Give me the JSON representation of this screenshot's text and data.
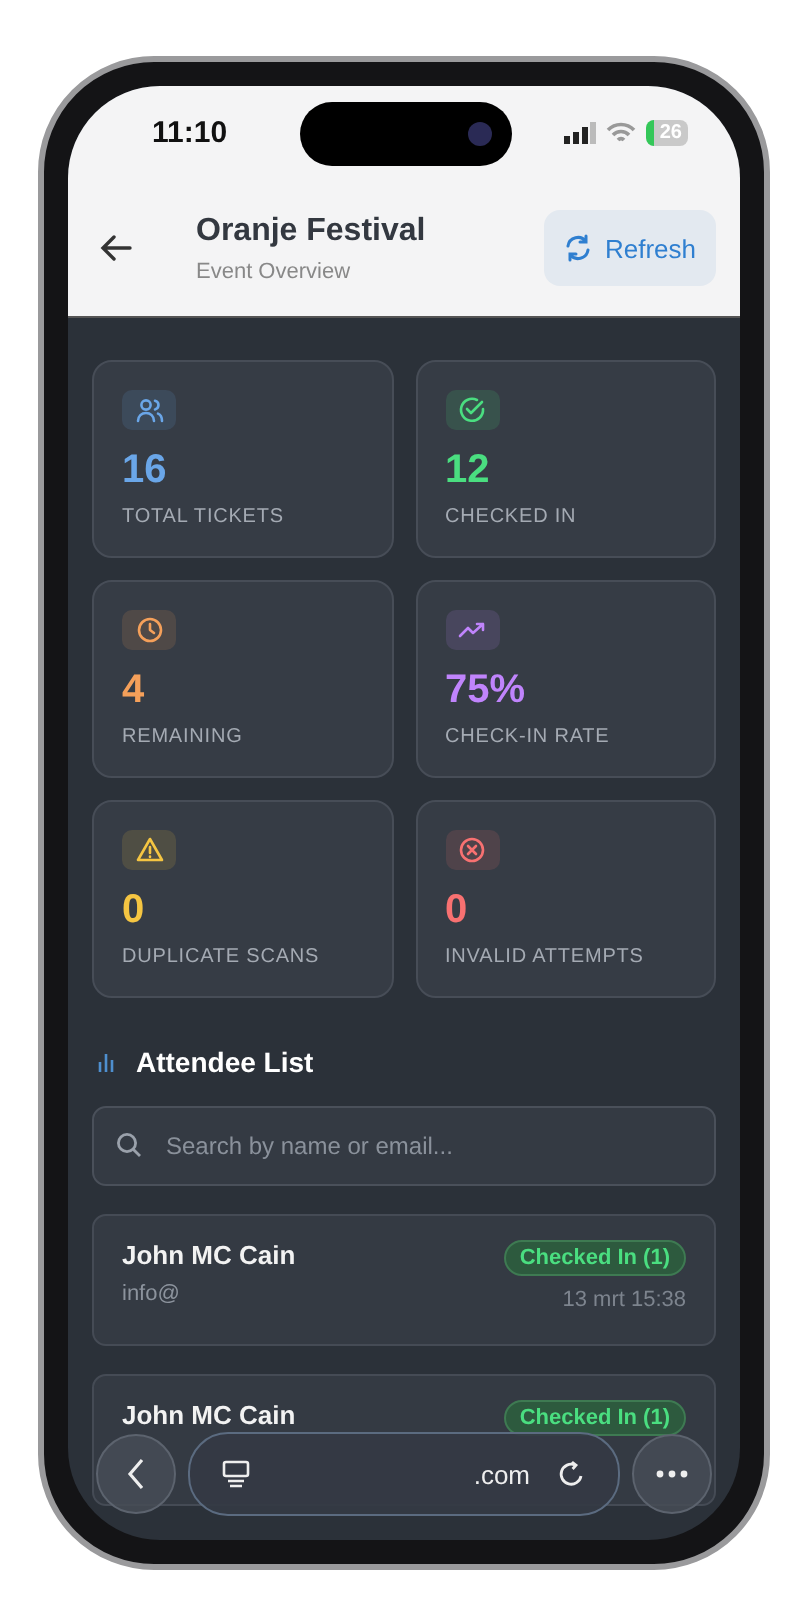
{
  "status_bar": {
    "time": "11:10",
    "battery": "26"
  },
  "header": {
    "title": "Oranje Festival",
    "subtitle": "Event Overview",
    "refresh": "Refresh"
  },
  "stats": [
    {
      "value": "16",
      "label": "TOTAL TICKETS",
      "color": "#6aa6e8"
    },
    {
      "value": "12",
      "label": "CHECKED IN",
      "color": "#4ade80"
    },
    {
      "value": "4",
      "label": "REMAINING",
      "color": "#f5a05a"
    },
    {
      "value": "75%",
      "label": "CHECK-IN RATE",
      "color": "#c084fc"
    },
    {
      "value": "0",
      "label": "DUPLICATE SCANS",
      "color": "#f5c542"
    },
    {
      "value": "0",
      "label": "INVALID ATTEMPTS",
      "color": "#f87171"
    }
  ],
  "attendees_title": "Attendee List",
  "search": {
    "placeholder": "Search by name or email..."
  },
  "attendees": [
    {
      "name": "John MC Cain",
      "email": "info@",
      "status": "Checked In (1)",
      "time": "13 mrt 15:38"
    },
    {
      "name": "John MC Cain",
      "status": "Checked In (1)"
    }
  ],
  "browser_bar": {
    "url": ".com"
  }
}
